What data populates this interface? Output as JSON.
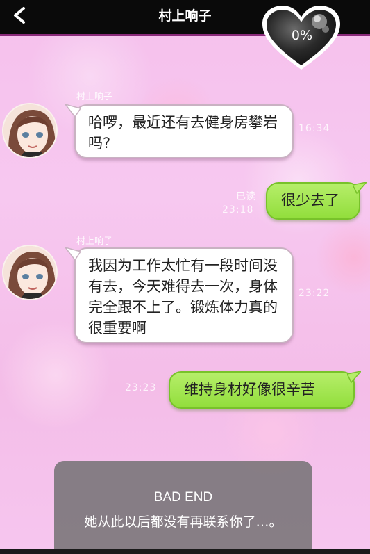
{
  "header": {
    "title": "村上响子",
    "affection_percent": "0%"
  },
  "messages": [
    {
      "sender": "村上响子",
      "side": "left",
      "text": "哈啰，最近还有去健身房攀岩吗?",
      "time": "16:34"
    },
    {
      "side": "right",
      "read_status": "已读",
      "text": "很少去了",
      "time": "23:18"
    },
    {
      "sender": "村上响子",
      "side": "left",
      "text": "我因为工作太忙有一段时间没有去，今天难得去一次，身体完全跟不上了。锻炼体力真的很重要啊",
      "time": "23:22"
    },
    {
      "side": "right",
      "text": "维持身材好像很辛苦",
      "time": "23:23"
    }
  ],
  "ending": {
    "title": "BAD END",
    "text": "她从此以后都没有再联系你了…。"
  },
  "colors": {
    "topbar": "#0a0a0a",
    "background": "#f7c6ef",
    "right_bubble": "#9be24a",
    "left_bubble": "#ffffff",
    "end_panel": "#6e6e6e"
  },
  "icons": [
    "back-arrow-icon",
    "heart-meter-icon",
    "avatar"
  ]
}
